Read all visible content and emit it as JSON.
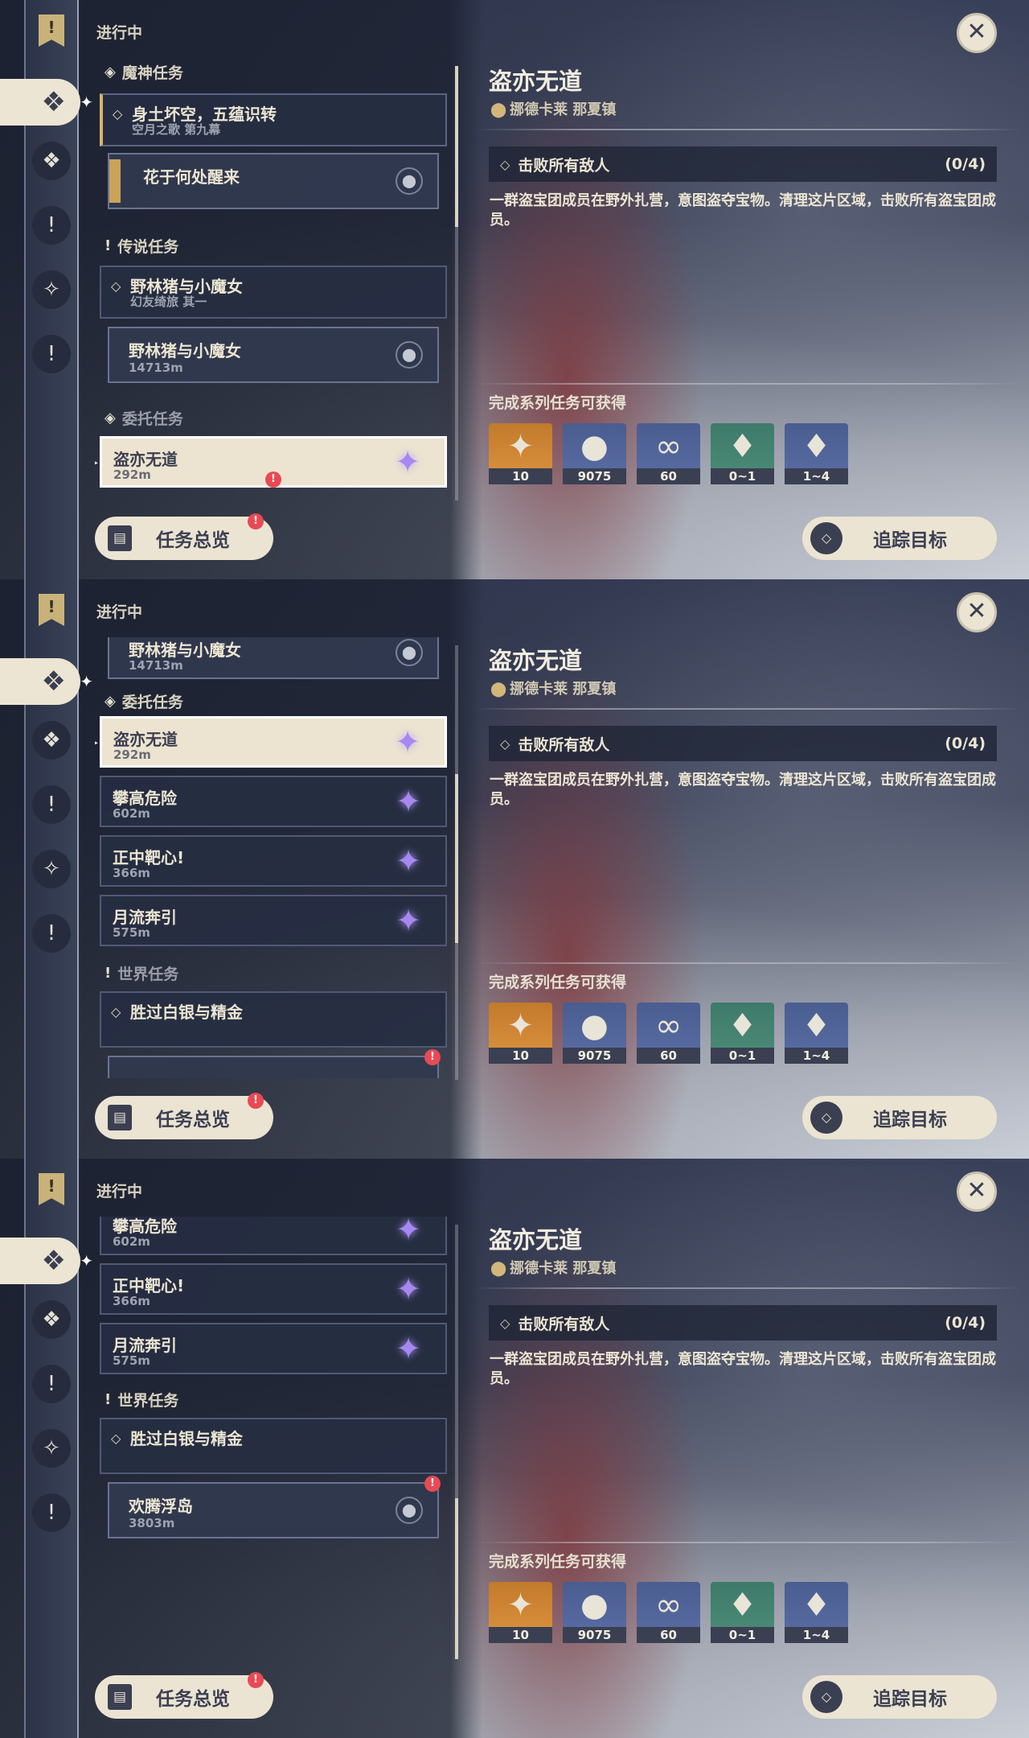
{
  "status_label": "进行中",
  "sections": {
    "archon": "魔神任务",
    "story": "传说任务",
    "commission": "委托任务",
    "world": "世界任务"
  },
  "quests": {
    "archon_main": {
      "title": "身土坏空，五蕴识转",
      "subtitle": "空月之歌 第九幕"
    },
    "archon_step": {
      "title": "花于何处醒来"
    },
    "story_main": {
      "title": "野林猪与小魔女",
      "subtitle": "幻友绮旅 其一"
    },
    "story_step": {
      "title": "野林猪与小魔女",
      "distance": "14713m"
    },
    "commissions": [
      {
        "title": "盗亦无道",
        "distance": "292m"
      },
      {
        "title": "攀高危险",
        "distance": "602m"
      },
      {
        "title": "正中靶心!",
        "distance": "366m"
      },
      {
        "title": "月流奔引",
        "distance": "575m"
      }
    ],
    "world_main": {
      "title": "胜过白银与精金"
    },
    "world_step": {
      "title": "欢腾浮岛",
      "distance": "3803m"
    }
  },
  "overview_label": "任务总览",
  "detail": {
    "title": "盗亦无道",
    "location": "挪德卡莱 那夏镇",
    "objective": "击败所有敌人",
    "objective_count": "(0/4)",
    "description": "一群盗宝团成员在野外扎营，意图盗夺宝物。清理这片区域，击败所有盗宝团成员。",
    "rewards_title": "完成系列任务可获得",
    "rewards": [
      {
        "icon": "primogem-icon",
        "qty": "10"
      },
      {
        "icon": "mora-icon",
        "qty": "9075"
      },
      {
        "icon": "exp-icon",
        "qty": "60"
      },
      {
        "icon": "crystal-green-icon",
        "qty": "0~1"
      },
      {
        "icon": "crystal-pink-icon",
        "qty": "1~4"
      }
    ],
    "track_label": "追踪目标"
  },
  "colors": {
    "cream": "#ece4d2",
    "dark": "#3b3f52",
    "alert": "#e84a55",
    "star": "#a787f0"
  }
}
